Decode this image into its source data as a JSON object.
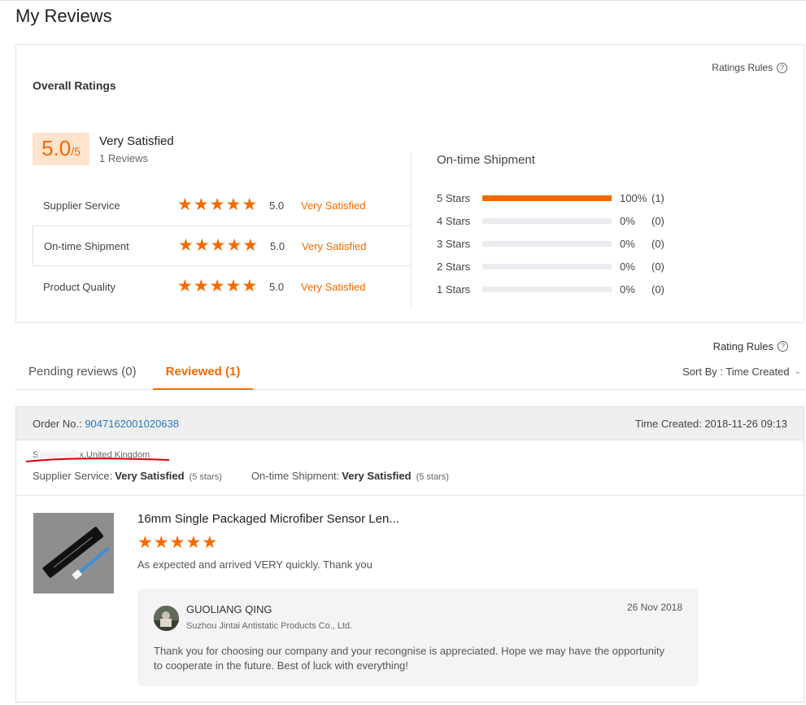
{
  "page": {
    "title": "My Reviews"
  },
  "overall": {
    "title": "Overall Ratings",
    "rules_label": "Ratings Rules",
    "score": "5.0",
    "score_suffix": "/5",
    "verdict": "Very Satisfied",
    "reviews_count": "1 Reviews",
    "dimensions": [
      {
        "name": "Supplier Service",
        "stars": 5,
        "score": "5.0",
        "verdict": "Very Satisfied"
      },
      {
        "name": "On-time Shipment",
        "stars": 5,
        "score": "5.0",
        "verdict": "Very Satisfied"
      },
      {
        "name": "Product Quality",
        "stars": 5,
        "score": "5.0",
        "verdict": "Very Satisfied"
      }
    ]
  },
  "distribution": {
    "title": "On-time Shipment",
    "rows": [
      {
        "label": "5 Stars",
        "fraction": 1.0,
        "percent": "100%",
        "count": "(1)"
      },
      {
        "label": "4 Stars",
        "fraction": 0,
        "percent": "0%",
        "count": "(0)"
      },
      {
        "label": "3 Stars",
        "fraction": 0,
        "percent": "0%",
        "count": "(0)"
      },
      {
        "label": "2 Stars",
        "fraction": 0,
        "percent": "0%",
        "count": "(0)"
      },
      {
        "label": "1 Stars",
        "fraction": 0,
        "percent": "0%",
        "count": "(0)"
      }
    ]
  },
  "rating_rules_label": "Rating Rules",
  "tabs": {
    "pending": "Pending reviews (0)",
    "reviewed": "Reviewed (1)",
    "sort_label": "Sort By : Time Created"
  },
  "review": {
    "order_label": "Order No.:",
    "order_no": "9047162001020638",
    "time_created": "Time Created: 2018-11-26 09:13",
    "buyer_prefix": "S",
    "buyer_location": "x,United Kingdom",
    "supplier_service_label": "Supplier Service:",
    "supplier_service_value": "Very Satisfied",
    "supplier_service_stars": "(5 stars)",
    "shipment_label": "On-time Shipment:",
    "shipment_value": "Very Satisfied",
    "shipment_stars": "(5 stars)",
    "product_title": "16mm Single Packaged Microfiber Sensor Len...",
    "rating": 5,
    "text": "As expected and arrived VERY quickly. Thank you",
    "reply": {
      "name": "GUOLIANG QING",
      "company": "Suzhou Jintai Antistatic Products Co., Ltd.",
      "date": "26 Nov 2018",
      "text": "Thank you for choosing our company and your recongnise is appreciated. Hope we may have the opportunity to cooperate in the future.  Best of luck with everything!"
    }
  },
  "colors": {
    "accent": "#f56a00",
    "link": "#2a7ac0",
    "bar_empty": "#ececf0"
  }
}
